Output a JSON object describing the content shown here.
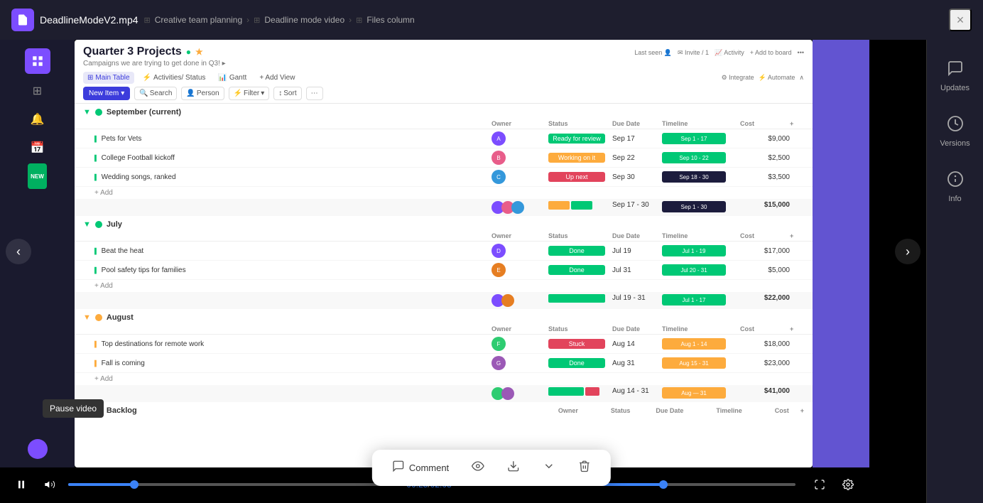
{
  "topbar": {
    "filename": "DeadlineModeV2.mp4",
    "close_label": "×",
    "breadcrumb": [
      {
        "label": "Creative team planning",
        "icon": "grid"
      },
      {
        "label": "Deadline mode video",
        "icon": "grid"
      },
      {
        "label": "Files column",
        "icon": "grid"
      }
    ]
  },
  "right_panel": {
    "items": [
      {
        "id": "updates",
        "icon": "💬",
        "label": "Updates"
      },
      {
        "id": "versions",
        "icon": "🕐",
        "label": "Versions"
      },
      {
        "id": "info",
        "icon": "ℹ️",
        "label": "Info"
      }
    ]
  },
  "video": {
    "current_time": "00:25",
    "total_time": "02:08",
    "progress_percent": 20,
    "volume_icon": "🔊",
    "pause_icon": "⏸",
    "fullscreen_icon": "⛶",
    "settings_icon": "⚙️"
  },
  "tooltip": {
    "text": "Pause video"
  },
  "bottom_bar": {
    "comment_label": "Comment",
    "comment_icon": "💬",
    "eye_icon": "👁",
    "download_icon": "⬇",
    "chevron_icon": "˅",
    "trash_icon": "🗑"
  },
  "board": {
    "title": "Quarter 3 Projects",
    "subtitle": "Campaigns we are trying to get done in Q3! ▸",
    "tabs": [
      {
        "label": "Main Table",
        "active": true
      },
      {
        "label": "Activities/ Status",
        "active": false
      },
      {
        "label": "Gantt",
        "active": false
      },
      {
        "label": "+ Add View",
        "active": false
      }
    ],
    "toolbar": {
      "new_item": "New Item",
      "search": "Search",
      "person": "Person",
      "filter": "Filter",
      "sort": "Sort"
    },
    "groups": [
      {
        "name": "September (current)",
        "color": "#00c875",
        "items": [
          {
            "name": "Pets for Vets",
            "status": "Ready for review",
            "status_color": "#00c875",
            "due": "Sep 17",
            "timeline": "Sep 1 - 17",
            "tl_color": "#00c875",
            "cost": "$9,000"
          },
          {
            "name": "College Football kickoff",
            "status": "Working on it",
            "status_color": "#fdab3d",
            "due": "Sep 22",
            "timeline": "Sep 10 - 22",
            "tl_color": "#00c875",
            "cost": "$2,500"
          },
          {
            "name": "Wedding songs, ranked",
            "status": "Up next",
            "status_color": "#e2445c",
            "due": "Sep 30",
            "timeline": "Sep 18 - 30",
            "tl_color": "#1c1c3d",
            "cost": "$3,500"
          }
        ],
        "sum": {
          "cost": "$15,000",
          "timeline": "Sep 17 - 30",
          "tl_sum": "Sep 1 - 30"
        }
      },
      {
        "name": "July",
        "color": "#00c875",
        "items": [
          {
            "name": "Beat the heat",
            "status": "Done",
            "status_color": "#00c875",
            "due": "Jul 19",
            "timeline": "Jul 1 - 19",
            "tl_color": "#00c875",
            "cost": "$17,000"
          },
          {
            "name": "Pool safety tips for families",
            "status": "Done",
            "status_color": "#00c875",
            "due": "Jul 31",
            "timeline": "Jul 20 - 31",
            "tl_color": "#00c875",
            "cost": "$5,000"
          }
        ],
        "sum": {
          "cost": "$22,000",
          "timeline": "Jul 19 - 31",
          "tl_sum": "Jul 1 - 17"
        }
      },
      {
        "name": "August",
        "color": "#fdab3d",
        "items": [
          {
            "name": "Top destinations for remote work",
            "status": "Stuck",
            "status_color": "#e2445c",
            "due": "Aug 14",
            "timeline": "Aug 1 - 14",
            "tl_color": "#fdab3d",
            "cost": "$18,000"
          },
          {
            "name": "Fall is coming",
            "status": "Done",
            "status_color": "#00c875",
            "due": "Aug 31",
            "timeline": "Aug 15 - 31",
            "tl_color": "#fdab3d",
            "cost": "$23,000"
          }
        ],
        "sum": {
          "cost": "$41,000",
          "timeline": "Aug 14 - 31",
          "tl_sum": "Aug — 31"
        }
      },
      {
        "name": "Backlog",
        "color": "#00c875",
        "items": []
      }
    ]
  }
}
